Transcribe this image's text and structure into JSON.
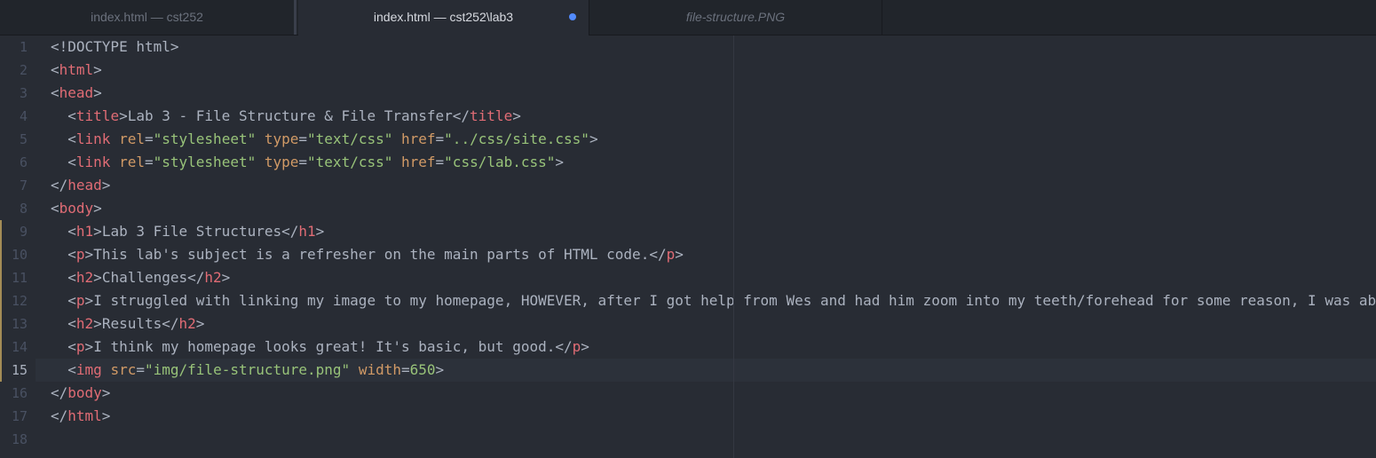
{
  "tabs": [
    {
      "label": "index.html — cst252",
      "active": false
    },
    {
      "label": "index.html — cst252\\lab3",
      "active": true,
      "modified": true
    },
    {
      "label": "file-structure.PNG",
      "active": false
    }
  ],
  "colors": {
    "tag": "#e06c75",
    "attr": "#d19a66",
    "string": "#98c379",
    "text": "#abb2bf",
    "modified_dot": "#528bff"
  },
  "editor": {
    "cursor_line": 15,
    "modified_lines": [
      9,
      10,
      11,
      12,
      13,
      14,
      15
    ],
    "lines": [
      {
        "n": "1",
        "tokens": [
          [
            "p",
            "<!DOCTYPE html>"
          ]
        ]
      },
      {
        "n": "2",
        "tokens": [
          [
            "p",
            "<"
          ],
          [
            "t",
            "html"
          ],
          [
            "p",
            ">"
          ]
        ]
      },
      {
        "n": "3",
        "tokens": [
          [
            "p",
            "<"
          ],
          [
            "t",
            "head"
          ],
          [
            "p",
            ">"
          ]
        ]
      },
      {
        "n": "4",
        "tokens": [
          [
            "p",
            "  <"
          ],
          [
            "t",
            "title"
          ],
          [
            "p",
            ">"
          ],
          [
            "x",
            "Lab 3 - File Structure & File Transfer"
          ],
          [
            "p",
            "</"
          ],
          [
            "t",
            "title"
          ],
          [
            "p",
            ">"
          ]
        ]
      },
      {
        "n": "5",
        "tokens": [
          [
            "p",
            "  <"
          ],
          [
            "t",
            "link"
          ],
          [
            "p",
            " "
          ],
          [
            "a",
            "rel"
          ],
          [
            "p",
            "="
          ],
          [
            "s",
            "\"stylesheet\""
          ],
          [
            "p",
            " "
          ],
          [
            "a",
            "type"
          ],
          [
            "p",
            "="
          ],
          [
            "s",
            "\"text/css\""
          ],
          [
            "p",
            " "
          ],
          [
            "a",
            "href"
          ],
          [
            "p",
            "="
          ],
          [
            "s",
            "\"../css/site.css\""
          ],
          [
            "p",
            ">"
          ]
        ]
      },
      {
        "n": "6",
        "tokens": [
          [
            "p",
            "  <"
          ],
          [
            "t",
            "link"
          ],
          [
            "p",
            " "
          ],
          [
            "a",
            "rel"
          ],
          [
            "p",
            "="
          ],
          [
            "s",
            "\"stylesheet\""
          ],
          [
            "p",
            " "
          ],
          [
            "a",
            "type"
          ],
          [
            "p",
            "="
          ],
          [
            "s",
            "\"text/css\""
          ],
          [
            "p",
            " "
          ],
          [
            "a",
            "href"
          ],
          [
            "p",
            "="
          ],
          [
            "s",
            "\"css/lab.css\""
          ],
          [
            "p",
            ">"
          ]
        ]
      },
      {
        "n": "7",
        "tokens": [
          [
            "p",
            "</"
          ],
          [
            "t",
            "head"
          ],
          [
            "p",
            ">"
          ]
        ]
      },
      {
        "n": "8",
        "tokens": [
          [
            "p",
            "<"
          ],
          [
            "t",
            "body"
          ],
          [
            "p",
            ">"
          ]
        ]
      },
      {
        "n": "9",
        "tokens": [
          [
            "p",
            "  <"
          ],
          [
            "t",
            "h1"
          ],
          [
            "p",
            ">"
          ],
          [
            "x",
            "Lab 3 File Structures"
          ],
          [
            "p",
            "</"
          ],
          [
            "t",
            "h1"
          ],
          [
            "p",
            ">"
          ]
        ]
      },
      {
        "n": "10",
        "tokens": [
          [
            "p",
            "  <"
          ],
          [
            "t",
            "p"
          ],
          [
            "p",
            ">"
          ],
          [
            "x",
            "This lab's subject is a refresher on the main parts of HTML code."
          ],
          [
            "p",
            "</"
          ],
          [
            "t",
            "p"
          ],
          [
            "p",
            ">"
          ]
        ]
      },
      {
        "n": "11",
        "tokens": [
          [
            "p",
            "  <"
          ],
          [
            "t",
            "h2"
          ],
          [
            "p",
            ">"
          ],
          [
            "x",
            "Challenges"
          ],
          [
            "p",
            "</"
          ],
          [
            "t",
            "h2"
          ],
          [
            "p",
            ">"
          ]
        ]
      },
      {
        "n": "12",
        "tokens": [
          [
            "p",
            "  <"
          ],
          [
            "t",
            "p"
          ],
          [
            "p",
            ">"
          ],
          [
            "x",
            "I struggled with linking my image to my homepage, HOWEVER, after I got help from Wes and had him zoom into my teeth/forehead for some reason, I was ab"
          ]
        ]
      },
      {
        "n": "13",
        "tokens": [
          [
            "p",
            "  <"
          ],
          [
            "t",
            "h2"
          ],
          [
            "p",
            ">"
          ],
          [
            "x",
            "Results"
          ],
          [
            "p",
            "</"
          ],
          [
            "t",
            "h2"
          ],
          [
            "p",
            ">"
          ]
        ]
      },
      {
        "n": "14",
        "tokens": [
          [
            "p",
            "  <"
          ],
          [
            "t",
            "p"
          ],
          [
            "p",
            ">"
          ],
          [
            "x",
            "I think my homepage looks great! It's basic, but good."
          ],
          [
            "p",
            "</"
          ],
          [
            "t",
            "p"
          ],
          [
            "p",
            ">"
          ]
        ]
      },
      {
        "n": "15",
        "tokens": [
          [
            "p",
            "  <"
          ],
          [
            "t",
            "img"
          ],
          [
            "p",
            " "
          ],
          [
            "a",
            "src"
          ],
          [
            "p",
            "="
          ],
          [
            "s",
            "\"img/file-structure.png\""
          ],
          [
            "p",
            " "
          ],
          [
            "a",
            "width"
          ],
          [
            "p",
            "="
          ],
          [
            "s",
            "650"
          ],
          [
            "p",
            ">"
          ]
        ]
      },
      {
        "n": "16",
        "tokens": [
          [
            "p",
            "</"
          ],
          [
            "t",
            "body"
          ],
          [
            "p",
            ">"
          ]
        ]
      },
      {
        "n": "17",
        "tokens": [
          [
            "p",
            "</"
          ],
          [
            "t",
            "html"
          ],
          [
            "p",
            ">"
          ]
        ]
      },
      {
        "n": "18",
        "tokens": []
      }
    ]
  }
}
